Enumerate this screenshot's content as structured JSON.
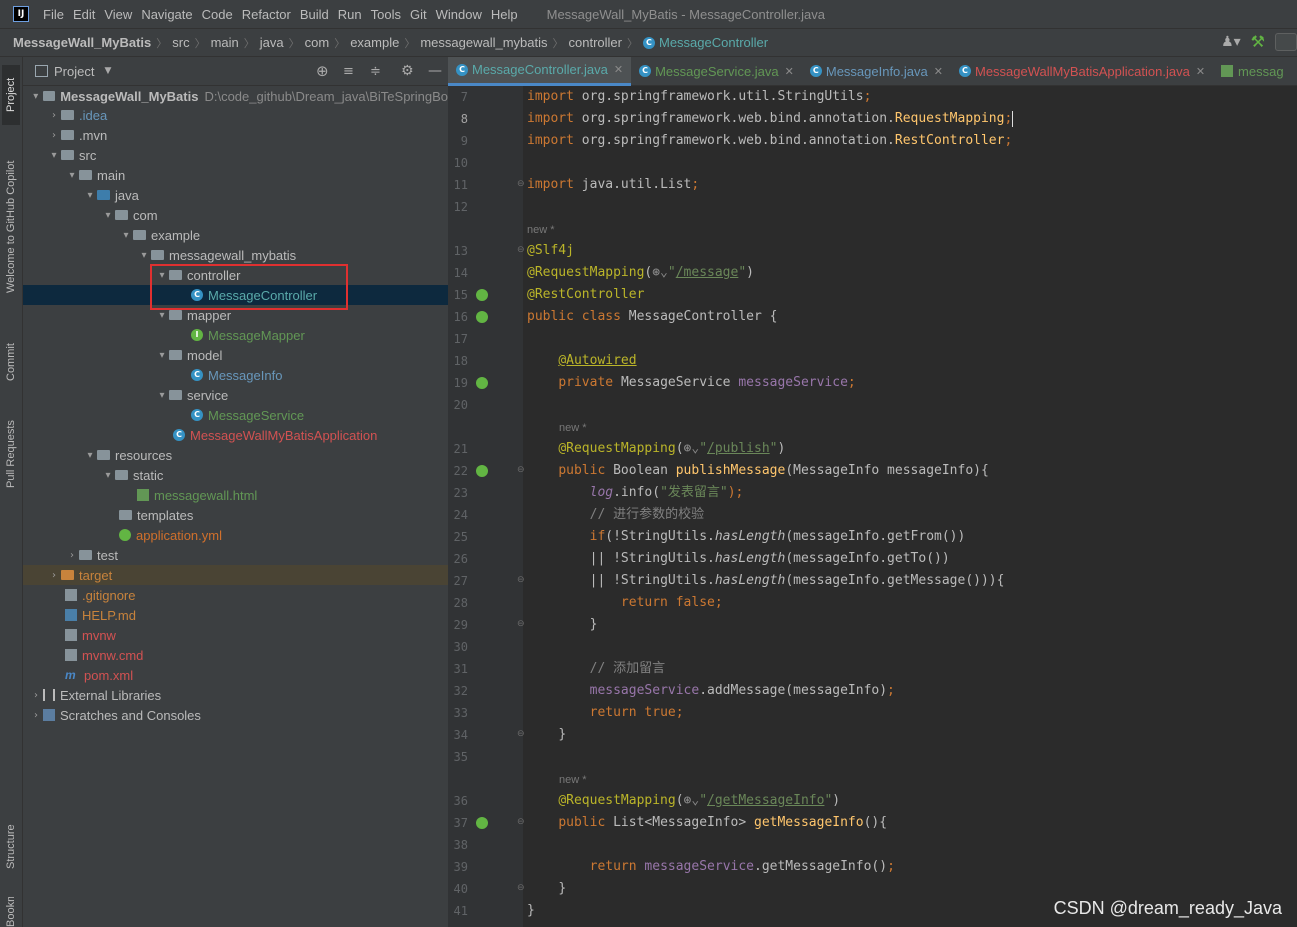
{
  "menubar": {
    "items": [
      "File",
      "Edit",
      "View",
      "Navigate",
      "Code",
      "Refactor",
      "Build",
      "Run",
      "Tools",
      "Git",
      "Window",
      "Help"
    ],
    "title": "MessageWall_MyBatis - MessageController.java"
  },
  "breadcrumbs": [
    "MessageWall_MyBatis",
    "src",
    "main",
    "java",
    "com",
    "example",
    "messagewall_mybatis",
    "controller",
    "MessageController"
  ],
  "left_strip": [
    "Project",
    "Welcome to GitHub Copilot",
    "Commit",
    "Pull Requests",
    "Structure",
    "Bookmarks"
  ],
  "project": {
    "header": "Project",
    "root": {
      "name": "MessageWall_MyBatis",
      "path": "D:\\code_github\\Dream_java\\BiTeSpringBo"
    },
    "items": [
      {
        "label": ".idea",
        "color": "#6897bb"
      },
      {
        "label": ".mvn",
        "color": "#bbbbbb"
      },
      {
        "label": "src",
        "color": "#bbbbbb"
      },
      {
        "label": "main",
        "color": "#bbbbbb"
      },
      {
        "label": "java",
        "color": "#bbbbbb"
      },
      {
        "label": "com",
        "color": "#bbbbbb"
      },
      {
        "label": "example",
        "color": "#bbbbbb"
      },
      {
        "label": "messagewall_mybatis",
        "color": "#bbbbbb"
      },
      {
        "label": "controller",
        "color": "#bbbbbb"
      },
      {
        "label": "MessageController",
        "color": "#5aaaaa"
      },
      {
        "label": "mapper",
        "color": "#bbbbbb"
      },
      {
        "label": "MessageMapper",
        "color": "#629755"
      },
      {
        "label": "model",
        "color": "#bbbbbb"
      },
      {
        "label": "MessageInfo",
        "color": "#6897bb"
      },
      {
        "label": "service",
        "color": "#bbbbbb"
      },
      {
        "label": "MessageService",
        "color": "#629755"
      },
      {
        "label": "MessageWallMyBatisApplication",
        "color": "#d25252"
      },
      {
        "label": "resources",
        "color": "#bbbbbb"
      },
      {
        "label": "static",
        "color": "#bbbbbb"
      },
      {
        "label": "messagewall.html",
        "color": "#629755"
      },
      {
        "label": "templates",
        "color": "#bbbbbb"
      },
      {
        "label": "application.yml",
        "color": "#d0702c"
      },
      {
        "label": "test",
        "color": "#bbbbbb"
      },
      {
        "label": "target",
        "color": "#c8833c"
      },
      {
        "label": ".gitignore",
        "color": "#c8833c"
      },
      {
        "label": "HELP.md",
        "color": "#c8833c"
      },
      {
        "label": "mvnw",
        "color": "#d25252"
      },
      {
        "label": "mvnw.cmd",
        "color": "#d25252"
      },
      {
        "label": "pom.xml",
        "color": "#d25252"
      },
      {
        "label": "External Libraries",
        "color": "#bbbbbb"
      },
      {
        "label": "Scratches and Consoles",
        "color": "#bbbbbb"
      }
    ]
  },
  "tabs": [
    {
      "label": "MessageController.java",
      "color": "#5aaaaa"
    },
    {
      "label": "MessageService.java",
      "color": "#629755"
    },
    {
      "label": "MessageInfo.java",
      "color": "#6897bb"
    },
    {
      "label": "MessageWallMyBatisApplication.java",
      "color": "#d25252"
    },
    {
      "label": "messag",
      "color": "#629755"
    }
  ],
  "editor": {
    "line_numbers": [
      "7",
      "8",
      "9",
      "10",
      "11",
      "12",
      "13",
      "14",
      "15",
      "16",
      "17",
      "18",
      "19",
      "20",
      "21",
      "22",
      "23",
      "24",
      "25",
      "26",
      "27",
      "28",
      "29",
      "30",
      "31",
      "32",
      "33",
      "34",
      "35",
      "36",
      "37",
      "38",
      "39",
      "40",
      "41"
    ],
    "current_line": "8",
    "hint": "new *",
    "code": {
      "l7_pkg": "org.springframework.util.",
      "l7_cls": "StringUtils",
      "l8_pkg": "org.springframework.web.bind.annotation.",
      "l8_cls": "RequestMapping",
      "l9_pkg": "org.springframework.web.bind.annotation.",
      "l9_cls": "RestController",
      "l11_pkg": "java.util.",
      "l11_cls": "List",
      "import": "import",
      "semi": ";",
      "l13": "@Slf4j",
      "l14_an": "@RequestMapping",
      "l14_path": "/message",
      "l15": "@RestController",
      "l16_public": "public",
      "l16_class": "class",
      "l16_name": "MessageController {",
      "l18": "@Autowired",
      "l19_private": "private",
      "l19_type": "MessageService",
      "l19_field": "messageService",
      "l21_path": "/publish",
      "l22_type": "Boolean",
      "l22_fn": "publishMessage",
      "l22_params": "(MessageInfo messageInfo){",
      "l23_log": "log",
      "l23_call": ".info(",
      "l23_str": "\"发表留言\"",
      "l23_end": ");",
      "l24": "// 进行参数的校验",
      "l25_if": "if",
      "l25_a": "(!StringUtils.",
      "l25_m": "hasLength",
      "l25_b": "(messageInfo.getFrom())",
      "l26_a": "|| !StringUtils.",
      "l26_b": "(messageInfo.getTo())",
      "l27_a": "|| !StringUtils.",
      "l27_b": "(messageInfo.getMessage())){",
      "l28_return": "return",
      "l28_val": "false",
      "l29": "}",
      "l31": "// 添加留言",
      "l32_call": ".addMessage(messageInfo)",
      "l33_val": "true",
      "l34": "}",
      "l36_path": "/getMessageInfo",
      "l37_type": "List<MessageInfo>",
      "l37_fn": "getMessageInfo",
      "l37_end": "(){",
      "l39_call": ".getMessageInfo()",
      "l40": "}",
      "l41": "}"
    }
  },
  "watermark": "CSDN @dream_ready_Java",
  "colors": {
    "keyword": "#cc7832",
    "annotation": "#bbb529",
    "string": "#6a8759",
    "field": "#9876aa",
    "function": "#ffc66d",
    "comment": "#808080"
  }
}
